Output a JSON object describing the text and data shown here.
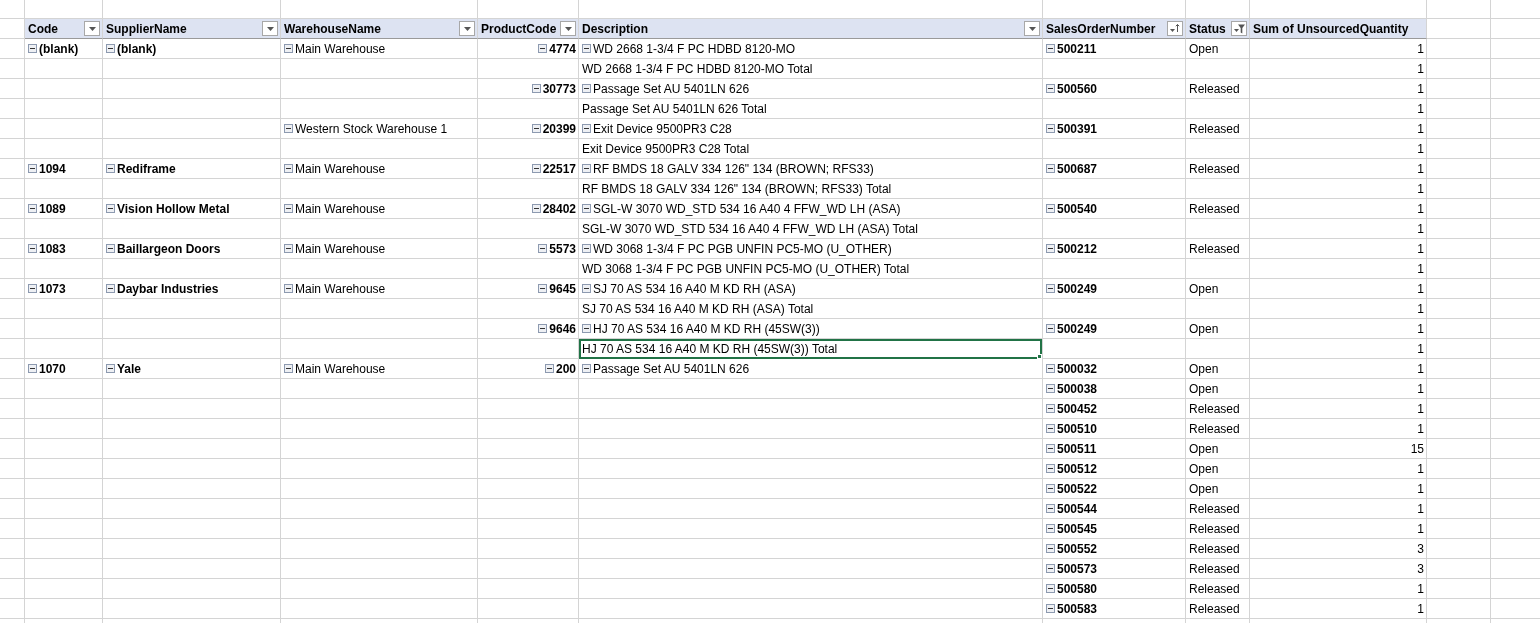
{
  "columns": [
    {
      "label": "Code",
      "kind": "dropdown"
    },
    {
      "label": "SupplierName",
      "kind": "dropdown"
    },
    {
      "label": "WarehouseName",
      "kind": "dropdown"
    },
    {
      "label": "ProductCode",
      "kind": "dropdown"
    },
    {
      "label": "Description",
      "kind": "dropdown"
    },
    {
      "label": "SalesOrderNumber",
      "kind": "sorted"
    },
    {
      "label": "Status",
      "kind": "filtered"
    },
    {
      "label": "Sum of UnsourcedQuantity",
      "kind": "plain"
    }
  ],
  "rows": [
    {
      "code": {
        "text": "(blank)",
        "expanded": true
      },
      "supplier": {
        "text": "(blank)",
        "expanded": true
      },
      "warehouse": {
        "text": "Main Warehouse",
        "expanded": true
      },
      "product": {
        "text": "4774",
        "expanded": true
      },
      "description": {
        "text": "WD 2668 1-3/4 F PC HDBD 8120-MO",
        "expanded": true,
        "selected": false
      },
      "order": {
        "text": "500211",
        "expanded": true
      },
      "status": {
        "text": "Open"
      },
      "qty": {
        "text": "1"
      }
    },
    {
      "description": {
        "text": "WD 2668 1-3/4 F PC HDBD 8120-MO Total",
        "selected": false
      },
      "qty": {
        "text": "1"
      }
    },
    {
      "product": {
        "text": "30773",
        "expanded": true
      },
      "description": {
        "text": "Passage Set AU 5401LN 626",
        "expanded": true,
        "selected": false
      },
      "order": {
        "text": "500560",
        "expanded": true
      },
      "status": {
        "text": "Released"
      },
      "qty": {
        "text": "1"
      }
    },
    {
      "description": {
        "text": "Passage Set AU 5401LN 626 Total",
        "selected": false
      },
      "qty": {
        "text": "1"
      }
    },
    {
      "warehouse": {
        "text": "Western Stock Warehouse 1",
        "expanded": true
      },
      "product": {
        "text": "20399",
        "expanded": true
      },
      "description": {
        "text": "Exit Device 9500PR3 C28",
        "expanded": true,
        "selected": false
      },
      "order": {
        "text": "500391",
        "expanded": true
      },
      "status": {
        "text": "Released"
      },
      "qty": {
        "text": "1"
      }
    },
    {
      "description": {
        "text": "Exit Device 9500PR3 C28 Total",
        "selected": false
      },
      "qty": {
        "text": "1"
      }
    },
    {
      "code": {
        "text": "1094",
        "expanded": true
      },
      "supplier": {
        "text": "Rediframe",
        "expanded": true
      },
      "warehouse": {
        "text": "Main Warehouse",
        "expanded": true
      },
      "product": {
        "text": "22517",
        "expanded": true
      },
      "description": {
        "text": "RF BMDS 18 GALV 334 126\" 134 (BROWN; RFS33)",
        "expanded": true,
        "selected": false
      },
      "order": {
        "text": "500687",
        "expanded": true
      },
      "status": {
        "text": "Released"
      },
      "qty": {
        "text": "1"
      }
    },
    {
      "description": {
        "text": "RF BMDS 18 GALV 334 126\" 134 (BROWN; RFS33) Total",
        "selected": false
      },
      "qty": {
        "text": "1"
      }
    },
    {
      "code": {
        "text": "1089",
        "expanded": true
      },
      "supplier": {
        "text": "Vision Hollow Metal",
        "expanded": true
      },
      "warehouse": {
        "text": "Main Warehouse",
        "expanded": true
      },
      "product": {
        "text": "28402",
        "expanded": true
      },
      "description": {
        "text": "SGL-W 3070 WD_STD 534 16 A40 4 FFW_WD LH (ASA)",
        "expanded": true,
        "selected": false
      },
      "order": {
        "text": "500540",
        "expanded": true
      },
      "status": {
        "text": "Released"
      },
      "qty": {
        "text": "1"
      }
    },
    {
      "description": {
        "text": "SGL-W 3070 WD_STD 534 16 A40 4 FFW_WD LH (ASA) Total",
        "selected": false
      },
      "qty": {
        "text": "1"
      }
    },
    {
      "code": {
        "text": "1083",
        "expanded": true
      },
      "supplier": {
        "text": "Baillargeon Doors",
        "expanded": true
      },
      "warehouse": {
        "text": "Main Warehouse",
        "expanded": true
      },
      "product": {
        "text": "5573",
        "expanded": true
      },
      "description": {
        "text": "WD 3068 1-3/4 F PC PGB UNFIN PC5-MO (U_OTHER)",
        "expanded": true,
        "selected": false
      },
      "order": {
        "text": "500212",
        "expanded": true
      },
      "status": {
        "text": "Released"
      },
      "qty": {
        "text": "1"
      }
    },
    {
      "description": {
        "text": "WD 3068 1-3/4 F PC PGB UNFIN PC5-MO (U_OTHER) Total",
        "selected": false
      },
      "qty": {
        "text": "1"
      }
    },
    {
      "code": {
        "text": "1073",
        "expanded": true
      },
      "supplier": {
        "text": "Daybar Industries",
        "expanded": true
      },
      "warehouse": {
        "text": "Main Warehouse",
        "expanded": true
      },
      "product": {
        "text": "9645",
        "expanded": true
      },
      "description": {
        "text": "SJ 70 AS 534 16 A40 M KD RH (ASA)",
        "expanded": true,
        "selected": false
      },
      "order": {
        "text": "500249",
        "expanded": true
      },
      "status": {
        "text": "Open"
      },
      "qty": {
        "text": "1"
      }
    },
    {
      "description": {
        "text": "SJ 70 AS 534 16 A40 M KD RH (ASA) Total",
        "selected": false
      },
      "qty": {
        "text": "1"
      }
    },
    {
      "product": {
        "text": "9646",
        "expanded": true
      },
      "description": {
        "text": "HJ 70 AS 534 16 A40 M KD RH (45SW(3))",
        "expanded": true,
        "selected": false
      },
      "order": {
        "text": "500249",
        "expanded": true
      },
      "status": {
        "text": "Open"
      },
      "qty": {
        "text": "1"
      }
    },
    {
      "description": {
        "text": "HJ 70 AS 534 16 A40 M KD RH (45SW(3)) Total",
        "selected": true
      },
      "qty": {
        "text": "1"
      }
    },
    {
      "code": {
        "text": "1070",
        "expanded": true
      },
      "supplier": {
        "text": "Yale",
        "expanded": true
      },
      "warehouse": {
        "text": "Main Warehouse",
        "expanded": true
      },
      "product": {
        "text": "200",
        "expanded": true
      },
      "description": {
        "text": "Passage Set AU 5401LN 626",
        "expanded": true,
        "selected": false
      },
      "order": {
        "text": "500032",
        "expanded": true
      },
      "status": {
        "text": "Open"
      },
      "qty": {
        "text": "1"
      }
    },
    {
      "order": {
        "text": "500038",
        "expanded": true
      },
      "status": {
        "text": "Open"
      },
      "qty": {
        "text": "1"
      }
    },
    {
      "order": {
        "text": "500452",
        "expanded": true
      },
      "status": {
        "text": "Released"
      },
      "qty": {
        "text": "1"
      }
    },
    {
      "order": {
        "text": "500510",
        "expanded": true
      },
      "status": {
        "text": "Released"
      },
      "qty": {
        "text": "1"
      }
    },
    {
      "order": {
        "text": "500511",
        "expanded": true
      },
      "status": {
        "text": "Open"
      },
      "qty": {
        "text": "15"
      }
    },
    {
      "order": {
        "text": "500512",
        "expanded": true
      },
      "status": {
        "text": "Open"
      },
      "qty": {
        "text": "1"
      }
    },
    {
      "order": {
        "text": "500522",
        "expanded": true
      },
      "status": {
        "text": "Open"
      },
      "qty": {
        "text": "1"
      }
    },
    {
      "order": {
        "text": "500544",
        "expanded": true
      },
      "status": {
        "text": "Released"
      },
      "qty": {
        "text": "1"
      }
    },
    {
      "order": {
        "text": "500545",
        "expanded": true
      },
      "status": {
        "text": "Released"
      },
      "qty": {
        "text": "1"
      }
    },
    {
      "order": {
        "text": "500552",
        "expanded": true
      },
      "status": {
        "text": "Released"
      },
      "qty": {
        "text": "3"
      }
    },
    {
      "order": {
        "text": "500573",
        "expanded": true
      },
      "status": {
        "text": "Released"
      },
      "qty": {
        "text": "3"
      }
    },
    {
      "order": {
        "text": "500580",
        "expanded": true
      },
      "status": {
        "text": "Released"
      },
      "qty": {
        "text": "1"
      }
    },
    {
      "order": {
        "text": "500583",
        "expanded": true
      },
      "status": {
        "text": "Released"
      },
      "qty": {
        "text": "1"
      }
    }
  ]
}
